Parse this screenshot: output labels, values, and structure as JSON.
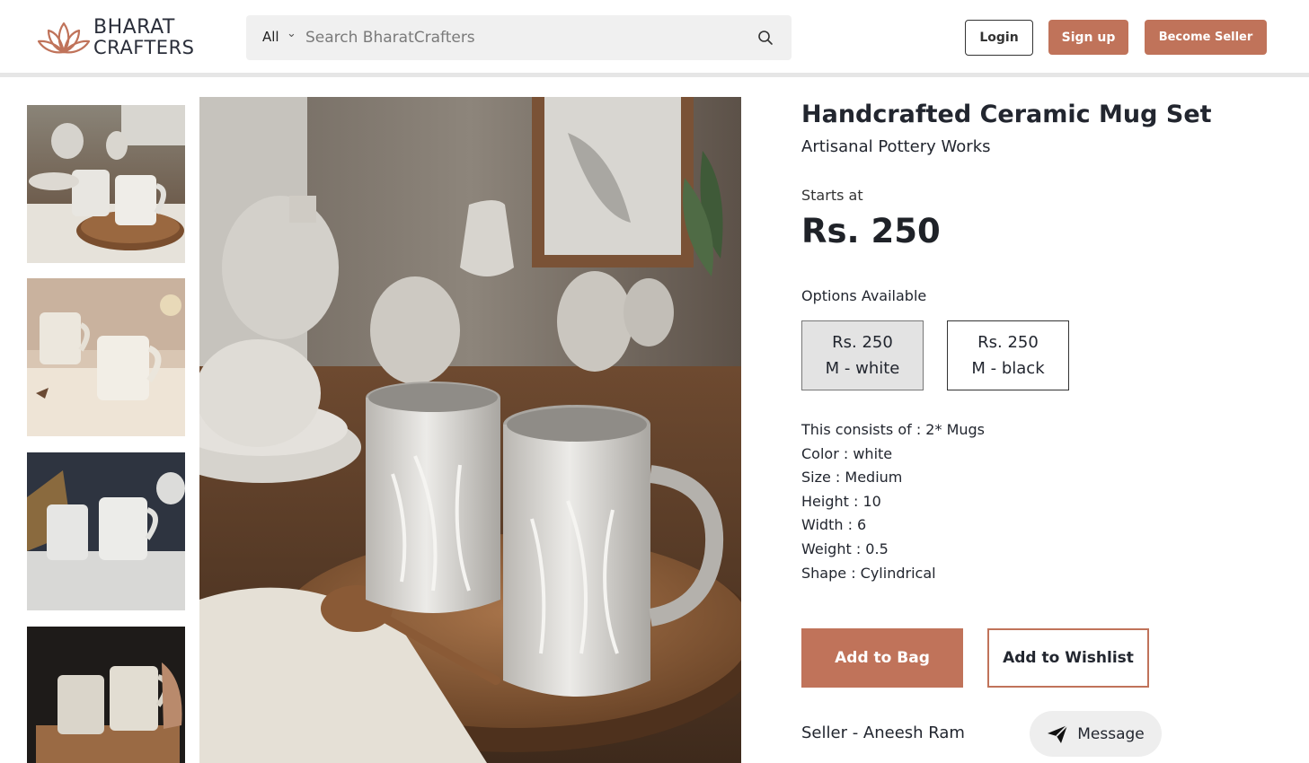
{
  "header": {
    "logo_line1": "BHARAT",
    "logo_line2": "CRAFTERS",
    "search": {
      "category": "All",
      "placeholder": "Search BharatCrafters"
    },
    "login_label": "Login",
    "signup_label": "Sign up",
    "seller_label": "Become Seller"
  },
  "colors": {
    "accent": "#c0735a",
    "text": "#22262f",
    "selected_option_bg": "#e3e3e3"
  },
  "gallery": {
    "thumbnails": [
      "mug-set-on-tray",
      "mugs-on-table",
      "mugs-with-wheat",
      "mugs-hand-held"
    ],
    "main_image": "ceramic-mugs-on-wooden-tray"
  },
  "product": {
    "title": "Handcrafted Ceramic Mug Set",
    "brand": "Artisanal Pottery Works",
    "starts_at_label": "Starts at",
    "price": "Rs. 250",
    "options_label": "Options Available",
    "options": [
      {
        "price": "Rs. 250",
        "variant": "M - white",
        "selected": true
      },
      {
        "price": "Rs. 250",
        "variant": "M - black",
        "selected": false
      }
    ],
    "specs": [
      "This consists of : 2* Mugs",
      "Color : white",
      "Size : Medium",
      "Height : 10",
      "Width : 6",
      "Weight : 0.5",
      "Shape : Cylindrical"
    ],
    "add_to_bag_label": "Add to Bag",
    "add_to_wishlist_label": "Add to Wishlist",
    "seller_text": "Seller - Aneesh Ram",
    "message_label": "Message"
  }
}
